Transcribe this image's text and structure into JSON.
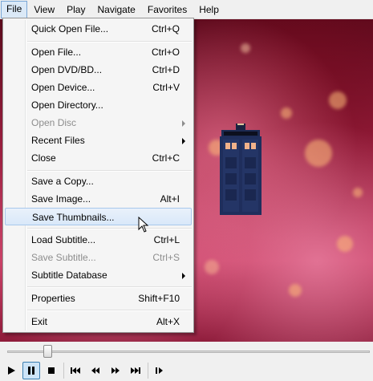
{
  "menubar": {
    "items": [
      "File",
      "View",
      "Play",
      "Navigate",
      "Favorites",
      "Help"
    ],
    "open_menu": "File"
  },
  "file_menu": {
    "items": [
      {
        "label": "Quick Open File...",
        "shortcut": "Ctrl+Q",
        "submenu": false,
        "disabled": false
      },
      {
        "label": "Open File...",
        "shortcut": "Ctrl+O",
        "submenu": false,
        "disabled": false
      },
      {
        "label": "Open DVD/BD...",
        "shortcut": "Ctrl+D",
        "submenu": false,
        "disabled": false
      },
      {
        "label": "Open Device...",
        "shortcut": "Ctrl+V",
        "submenu": false,
        "disabled": false
      },
      {
        "label": "Open Directory...",
        "shortcut": "",
        "submenu": false,
        "disabled": false
      },
      {
        "label": "Open Disc",
        "shortcut": "",
        "submenu": true,
        "disabled": true
      },
      {
        "label": "Recent Files",
        "shortcut": "",
        "submenu": true,
        "disabled": false
      },
      {
        "label": "Close",
        "shortcut": "Ctrl+C",
        "submenu": false,
        "disabled": false
      },
      {
        "label": "Save a Copy...",
        "shortcut": "",
        "submenu": false,
        "disabled": false
      },
      {
        "label": "Save Image...",
        "shortcut": "Alt+I",
        "submenu": false,
        "disabled": false
      },
      {
        "label": "Save Thumbnails...",
        "shortcut": "",
        "submenu": false,
        "disabled": false,
        "highlighted": true
      },
      {
        "label": "Load Subtitle...",
        "shortcut": "Ctrl+L",
        "submenu": false,
        "disabled": false
      },
      {
        "label": "Save Subtitle...",
        "shortcut": "Ctrl+S",
        "submenu": false,
        "disabled": true
      },
      {
        "label": "Subtitle Database",
        "shortcut": "",
        "submenu": true,
        "disabled": false
      },
      {
        "label": "Properties",
        "shortcut": "Shift+F10",
        "submenu": false,
        "disabled": false
      },
      {
        "label": "Exit",
        "shortcut": "Alt+X",
        "submenu": false,
        "disabled": false
      }
    ]
  },
  "player": {
    "seek_position": 0.11,
    "controls": [
      "play-icon",
      "pause-icon",
      "stop-icon",
      "skip-back-icon",
      "frame-back-icon",
      "frame-forward-icon",
      "skip-forward-icon",
      "frame-step-icon"
    ],
    "active_control": "pause-icon"
  },
  "colors": {
    "menu_highlight": "#d9e8f9",
    "menu_highlight_border": "#a8c8ec",
    "disabled_text": "#8d8d8d",
    "video_bg": "#9a1f3f"
  }
}
